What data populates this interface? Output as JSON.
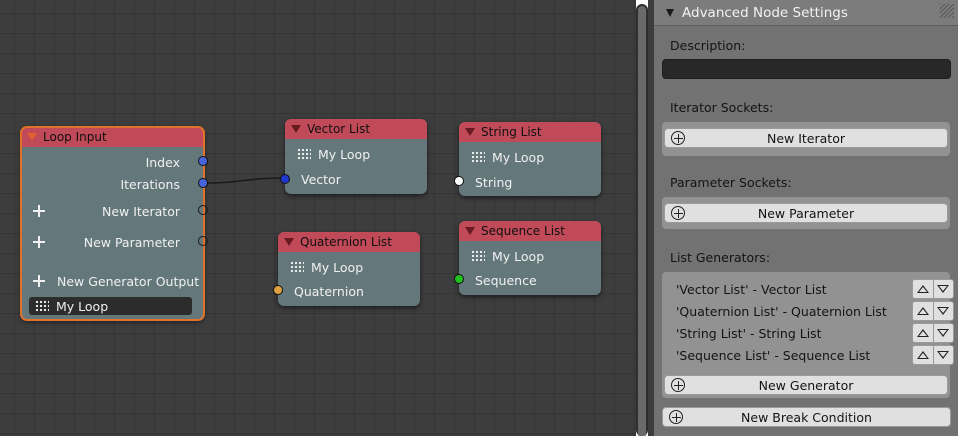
{
  "nodes": {
    "loop_input": {
      "title": "Loop Input",
      "outputs": [
        "Index",
        "Iterations"
      ],
      "new_iterator": "New Iterator",
      "new_parameter": "New Parameter",
      "new_generator_output": "New Generator Output",
      "loop_name": "My Loop"
    },
    "vector_list": {
      "title": "Vector List",
      "loop": "My Loop",
      "input": "Vector"
    },
    "string_list": {
      "title": "String List",
      "loop": "My Loop",
      "input": "String"
    },
    "quaternion_list": {
      "title": "Quaternion List",
      "loop": "My Loop",
      "input": "Quaternion"
    },
    "sequence_list": {
      "title": "Sequence List",
      "loop": "My Loop",
      "input": "Sequence"
    }
  },
  "panel": {
    "title": "Advanced Node Settings",
    "description_label": "Description:",
    "description_value": "",
    "iterator_label": "Iterator Sockets:",
    "new_iterator": "New Iterator",
    "parameter_label": "Parameter Sockets:",
    "new_parameter": "New Parameter",
    "generators_label": "List Generators:",
    "generators": [
      "'Vector List' - Vector List",
      "'Quaternion List' - Quaternion List",
      "'String List' - String List",
      "'Sequence List' - Sequence List"
    ],
    "new_generator": "New Generator",
    "new_break_condition": "New Break Condition"
  },
  "colors": {
    "node_header": "#c04a58",
    "node_body": "#64787c",
    "selected_outline": "#e0722a",
    "socket_vector": "#4a64e0",
    "socket_string": "#ffffff",
    "socket_quaternion": "#e0a040",
    "socket_sequence": "#20c020"
  }
}
